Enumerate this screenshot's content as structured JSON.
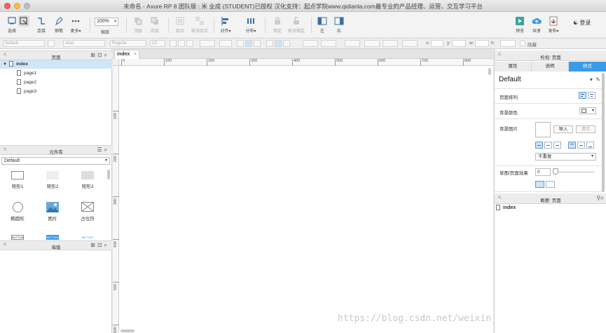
{
  "window": {
    "title": "未命名 - Axure RP 8 团队版 : 米 业成 (STUDENT)已授权 汉化支持：起点学院www.qidianla.com最专业的产品经理、运营、交互学习平台"
  },
  "toolbar": {
    "select": "选择",
    "connect": "连接",
    "pen": "钢笔",
    "more": "更多▾",
    "zoom_value": "100%",
    "zoom_label": "缩放",
    "top": "顶层",
    "bottom": "底层",
    "group": "组合",
    "ungroup": "取消组合",
    "align": "对齐▾",
    "distribute": "分布▾",
    "lock": "锁定",
    "unlock": "取消锁定",
    "left": "左",
    "right": "右",
    "preview": "预览",
    "share": "共享",
    "publish": "发布▾",
    "login": "登录"
  },
  "formatbar": {
    "style": "Default",
    "font": "Arial",
    "weight": "Regular",
    "size": "13",
    "x_label": "x:",
    "y_label": "y:",
    "w_label": "w:",
    "h_label": "h:",
    "hidden_label": "隐藏"
  },
  "pages_panel": {
    "title": "页面",
    "root": "index",
    "pages": [
      "page1",
      "page2",
      "page3"
    ]
  },
  "library_panel": {
    "title": "元件库",
    "selected_library": "Default",
    "widgets": [
      "矩形1",
      "矩形2",
      "矩形3",
      "椭圆形",
      "图片",
      "占位符"
    ],
    "button_labels": [
      "BUTTON",
      "BUTTON",
      "BUTTON"
    ]
  },
  "masters_panel": {
    "title": "母版"
  },
  "canvas": {
    "tab": "index",
    "ruler_h": [
      "0",
      "100",
      "200",
      "300",
      "400",
      "500",
      "600",
      "700",
      "800"
    ],
    "ruler_v": [
      "100",
      "200",
      "300",
      "400",
      "500",
      "600"
    ],
    "watermark": "https://blog.csdn.net/weixin_40845074"
  },
  "inspector": {
    "title": "检视: 页面",
    "tabs": [
      "属性",
      "说明",
      "样式"
    ],
    "active_tab": "样式",
    "style_name": "Default",
    "page_align_label": "页面排列",
    "bg_color_label": "背景颜色",
    "bg_image_label": "背景图片",
    "import_button": "导入",
    "clear_button": "清空",
    "repeat_value": "不重复",
    "sketch_label": "草图/页面效果",
    "sketch_value": "0"
  },
  "outline_panel": {
    "title": "概要: 页面",
    "root": "index"
  },
  "colors": {
    "accent": "#3c9be6",
    "selection": "#cfe6f7"
  }
}
